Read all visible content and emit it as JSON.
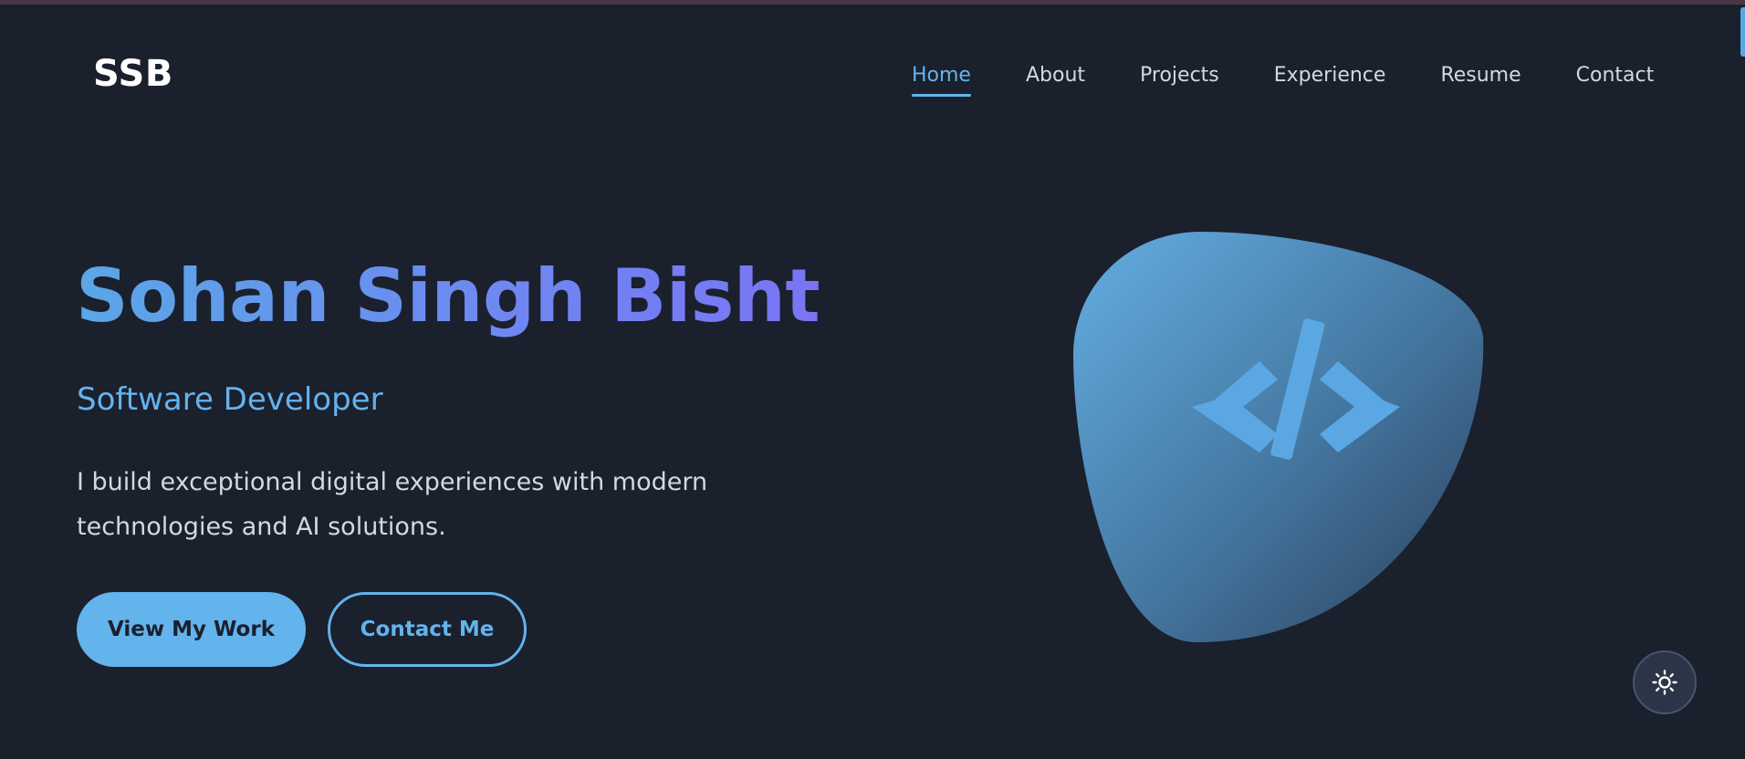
{
  "nav": {
    "logo": "SSB",
    "links": [
      {
        "label": "Home",
        "active": true
      },
      {
        "label": "About",
        "active": false
      },
      {
        "label": "Projects",
        "active": false
      },
      {
        "label": "Experience",
        "active": false
      },
      {
        "label": "Resume",
        "active": false
      },
      {
        "label": "Contact",
        "active": false
      }
    ]
  },
  "hero": {
    "name": "Sohan Singh Bisht",
    "role": "Software Developer",
    "description": "I build exceptional digital experiences with modern technologies and AI solutions.",
    "primary_button": "View My Work",
    "secondary_button": "Contact Me",
    "illustration_icon": "code-icon"
  },
  "theme_toggle": {
    "icon": "sun-icon"
  },
  "colors": {
    "background": "#1b202d",
    "accent": "#63b3ed",
    "gradient_end": "#7a74f5",
    "text": "#d3d8e3"
  }
}
